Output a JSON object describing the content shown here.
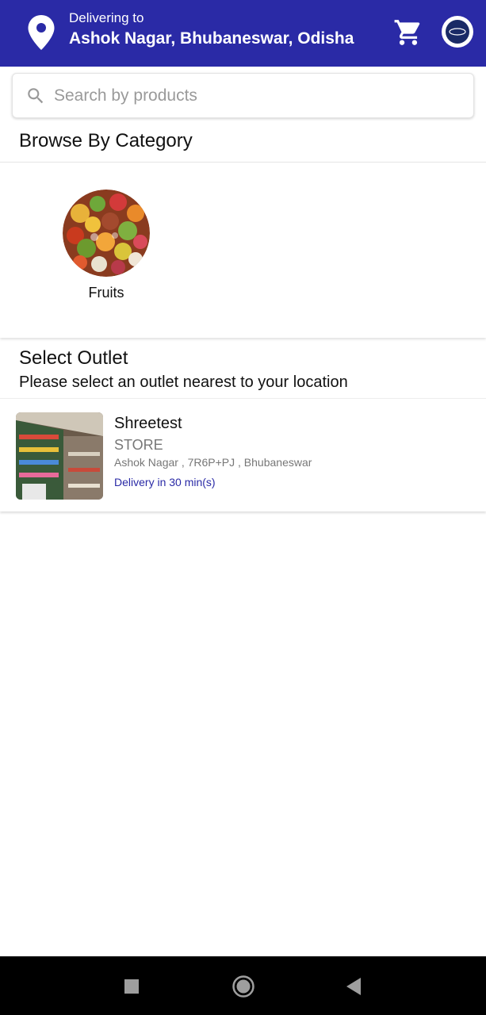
{
  "header": {
    "delivering_label": "Delivering to",
    "address": "Ashok Nagar, Bhubaneswar, Odisha",
    "background_color": "#2a2aa6",
    "location_icon": "location-pin-icon",
    "cart_icon": "shopping-cart-icon",
    "avatar_icon": "profile-avatar"
  },
  "search": {
    "placeholder": "Search by products",
    "value": "",
    "icon": "search-icon"
  },
  "categories": {
    "title": "Browse By Category",
    "items": [
      {
        "label": "Fruits",
        "image": "fruits-photo"
      }
    ]
  },
  "outlets": {
    "title": "Select Outlet",
    "subtitle": "Please select an outlet nearest to your location",
    "items": [
      {
        "name": "Shreetest",
        "type": "STORE",
        "address": "Ashok Nagar , 7R6P+PJ , Bhubaneswar",
        "delivery": "Delivery in 30 min(s)",
        "image": "store-photo"
      }
    ]
  },
  "navbar": {
    "recents_icon": "recents-square-icon",
    "home_icon": "home-circle-icon",
    "back_icon": "back-triangle-icon"
  }
}
